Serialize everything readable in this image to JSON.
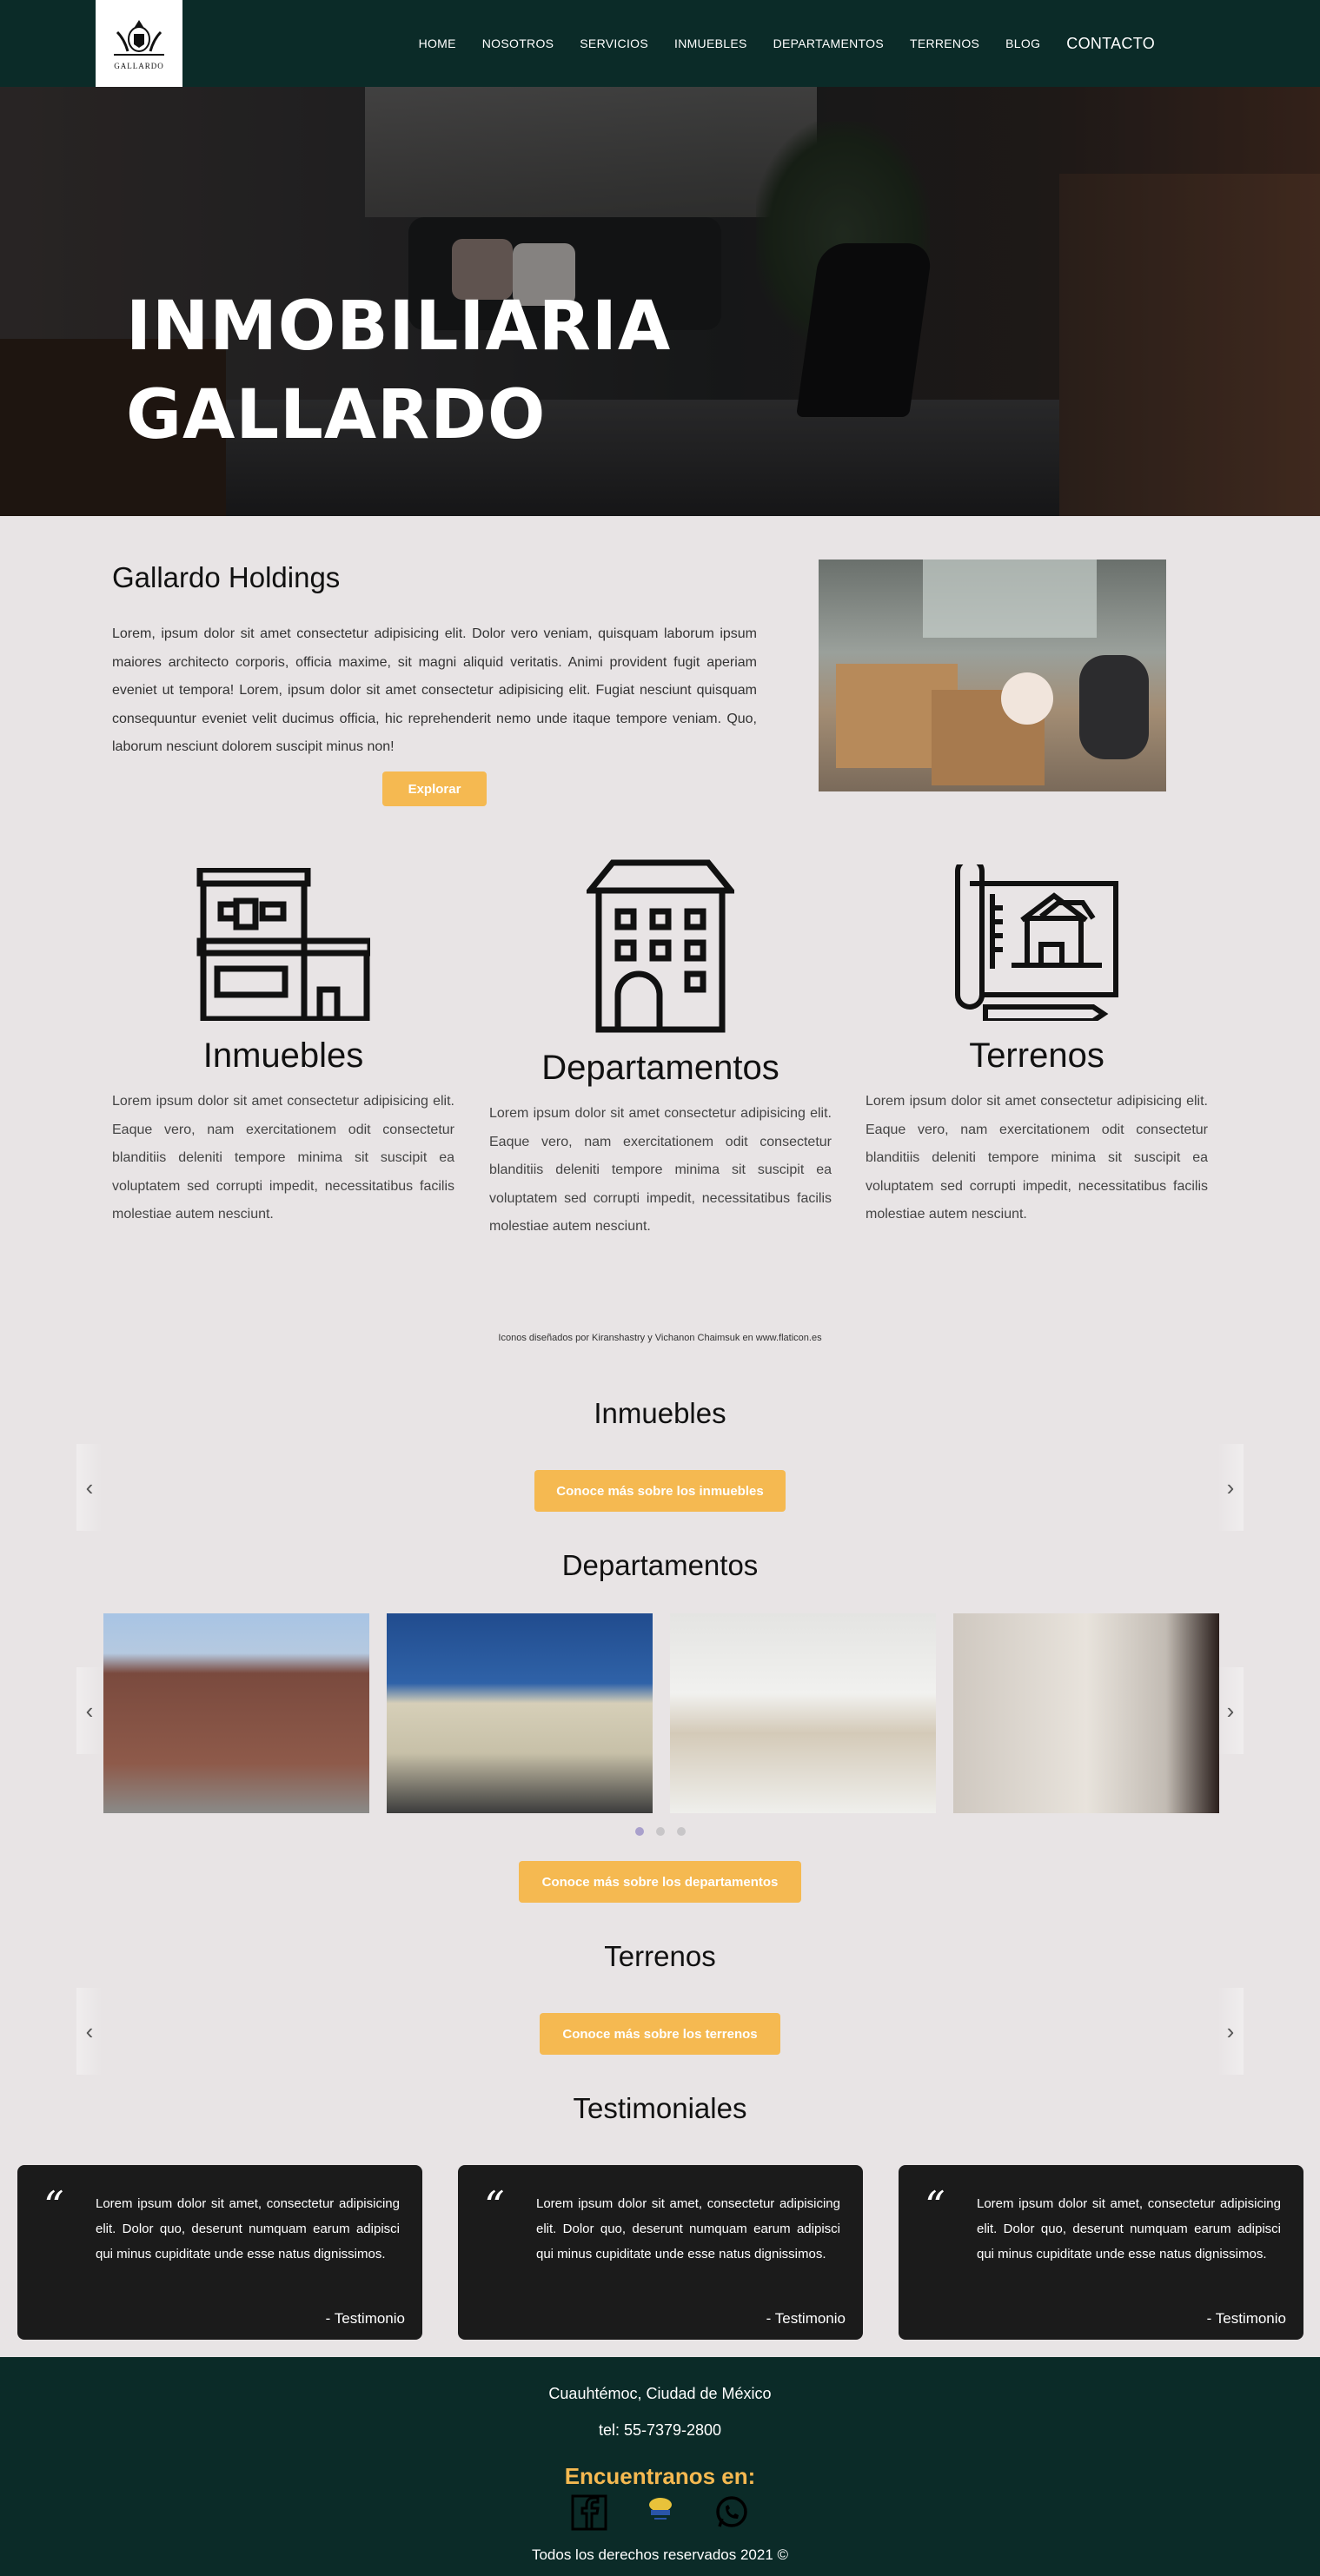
{
  "nav": {
    "logo_text": "GALLARDO",
    "links": [
      "HOME",
      "NOSOTROS",
      "SERVICIOS",
      "INMUEBLES",
      "DEPARTAMENTOS",
      "TERRENOS",
      "BLOG",
      "CONTACTO"
    ]
  },
  "hero": {
    "title_line1": "INMOBILIARIA",
    "title_line2": "GALLARDO"
  },
  "about": {
    "title": "Gallardo Holdings",
    "text": "Lorem, ipsum dolor sit amet consectetur adipisicing elit. Dolor vero veniam, quisquam laborum ipsum maiores architecto corporis, officia maxime, sit magni aliquid veritatis. Animi provident fugit aperiam eveniet ut tempora! Lorem, ipsum dolor sit amet consectetur adipisicing elit. Fugiat nesciunt quisquam consequuntur eveniet velit ducimus officia, hic reprehenderit nemo unde itaque tempore veniam. Quo, laborum nesciunt dolorem suscipit minus non!",
    "button": "Explorar"
  },
  "services": [
    {
      "title": "Inmuebles",
      "text": "Lorem ipsum dolor sit amet consectetur adipisicing elit. Eaque vero, nam exercitationem odit consectetur blanditiis deleniti tempore minima sit suscipit ea voluptatem sed corrupti impedit, necessitatibus facilis molestiae autem nesciunt."
    },
    {
      "title": "Departamentos",
      "text": "Lorem ipsum dolor sit amet consectetur adipisicing elit. Eaque vero, nam exercitationem odit consectetur blanditiis deleniti tempore minima sit suscipit ea voluptatem sed corrupti impedit, necessitatibus facilis molestiae autem nesciunt."
    },
    {
      "title": "Terrenos",
      "text": "Lorem ipsum dolor sit amet consectetur adipisicing elit. Eaque vero, nam exercitationem odit consectetur blanditiis deleniti tempore minima sit suscipit ea voluptatem sed corrupti impedit, necessitatibus facilis molestiae autem nesciunt."
    }
  ],
  "credit": "Iconos diseñados por Kiranshastry y Vichanon Chaimsuk en www.flaticon.es",
  "inmuebles": {
    "title": "Inmuebles",
    "button": "Conoce más sobre los inmuebles"
  },
  "departamentos": {
    "title": "Departamentos",
    "button": "Conoce más sobre los departamentos"
  },
  "terrenos": {
    "title": "Terrenos",
    "button": "Conoce más sobre los terrenos"
  },
  "testimonials": {
    "title": "Testimoniales",
    "items": [
      {
        "text": "Lorem ipsum dolor sit amet, consectetur adipisicing elit. Dolor quo, deserunt numquam earum adipisci qui minus cupiditate unde esse natus dignissimos.",
        "author": "- Testimonio"
      },
      {
        "text": "Lorem ipsum dolor sit amet, consectetur adipisicing elit. Dolor quo, deserunt numquam earum adipisci qui minus cupiditate unde esse natus dignissimos.",
        "author": "- Testimonio"
      },
      {
        "text": "Lorem ipsum dolor sit amet, consectetur adipisicing elit. Dolor quo, deserunt numquam earum adipisci qui minus cupiditate unde esse natus dignissimos.",
        "author": "- Testimonio"
      }
    ]
  },
  "footer": {
    "address": "Cuauhtémoc, Ciudad de México",
    "phone": "tel: 55-7379-2800",
    "find_us": "Encuentranos en:",
    "rights": "Todos los derechos reservados 2021 ©"
  },
  "colors": {
    "nav_bg": "#0b2b28",
    "accent": "#f5b951",
    "page_bg": "#e8e4e5",
    "card_bg": "#1b1b1b"
  }
}
